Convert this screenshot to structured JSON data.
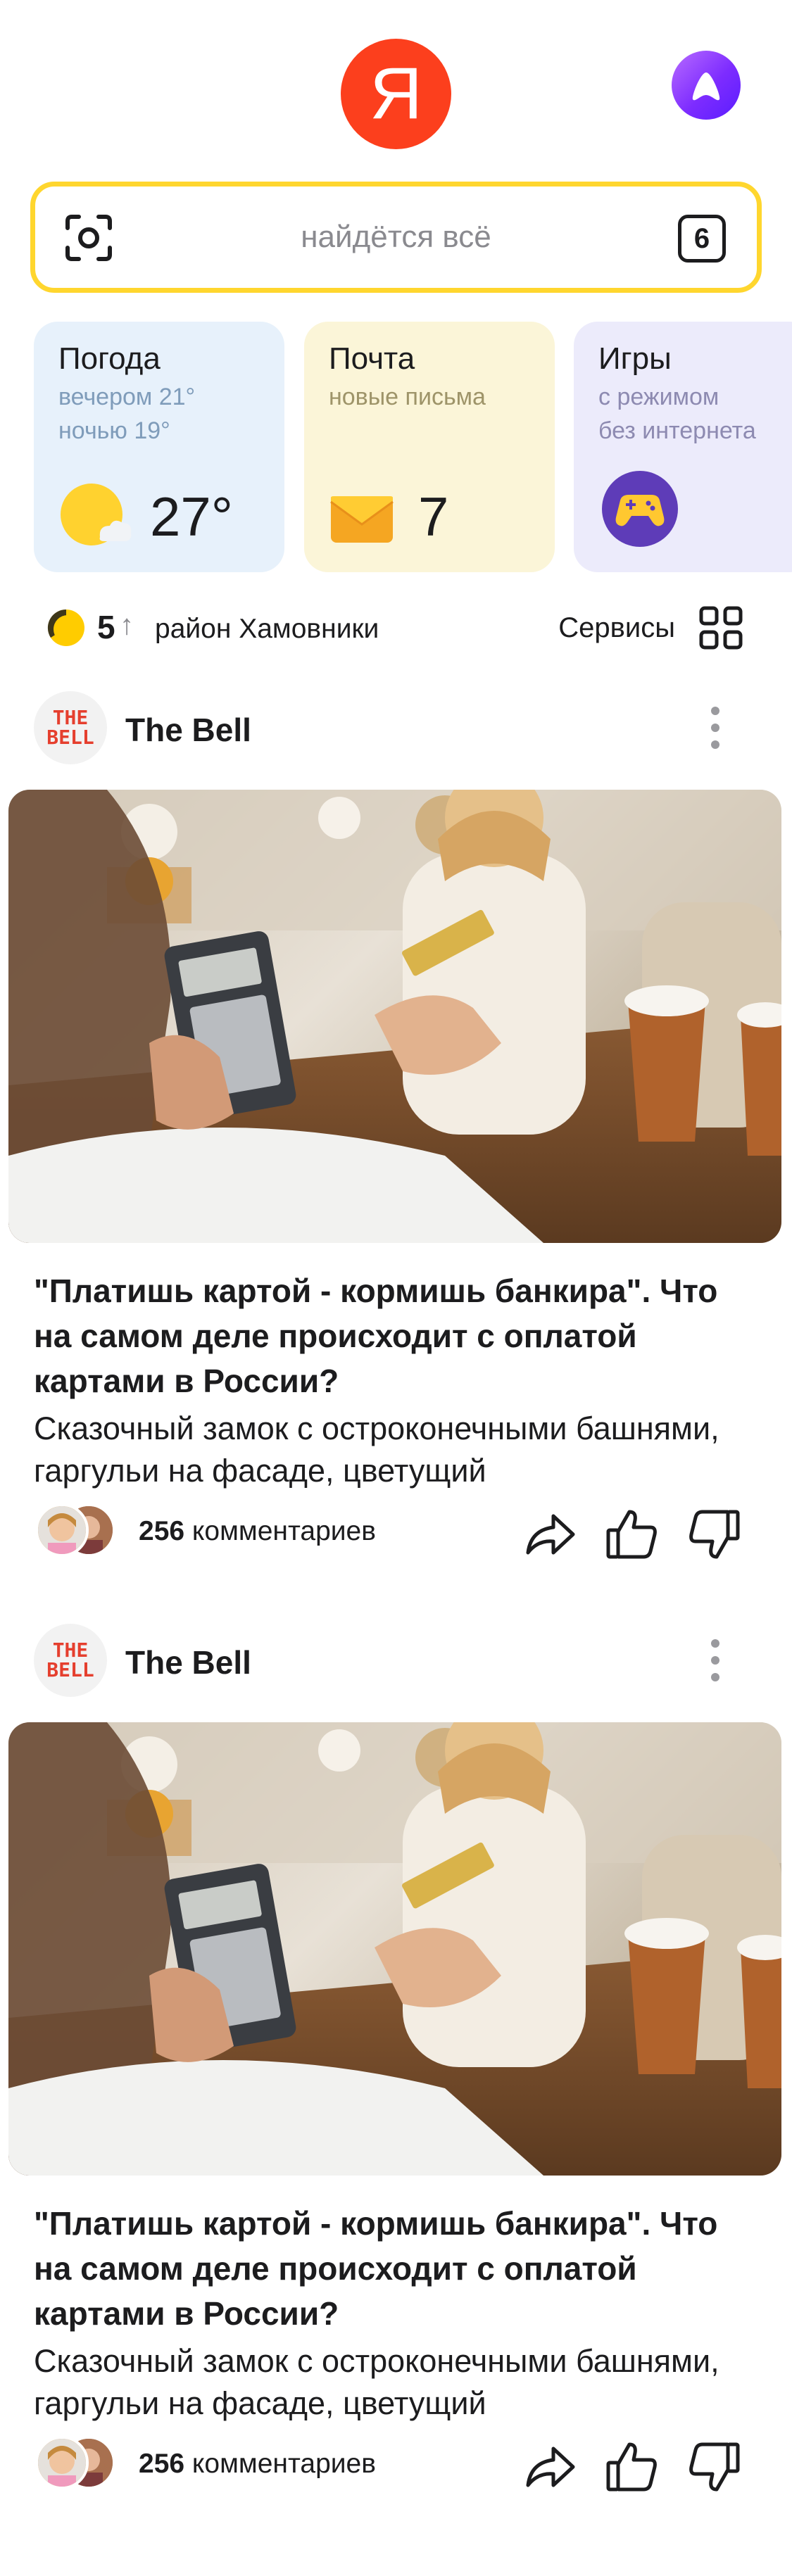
{
  "header": {
    "logo_letter": "Я",
    "brand_color": "#fc3f1d",
    "assistant_icon": "alice-icon"
  },
  "search": {
    "placeholder": "найдётся всё",
    "tabs_count": "6",
    "border_color": "#ffd62e",
    "camera_icon": "camera-search-icon"
  },
  "widgets": [
    {
      "title": "Погода",
      "sub_line1": "вечером 21°",
      "sub_line2": "ночью 19°",
      "value": "27°",
      "icon": "sun-cloud-icon"
    },
    {
      "title": "Почта",
      "sub_line1": "новые письма",
      "value": "7",
      "icon": "envelope-icon"
    },
    {
      "title": "Игры",
      "sub_line1": "с режимом",
      "sub_line2": "без интернета",
      "icon": "gamepad-icon"
    }
  ],
  "infobar": {
    "traffic_level": "5",
    "traffic_arrow": "↑",
    "district": "район Хамовники",
    "services_label": "Сервисы"
  },
  "posts": [
    {
      "source_logo_line1": "THE",
      "source_logo_line2": "BELL",
      "source_name": "The Bell",
      "headline": "\"Платишь картой - кормишь банкира\". Что на самом деле происходит с оплатой картами в России?",
      "lead": "Сказочный замок с остроконечными башнями, гаргульи на фасаде, цветущий",
      "comments_count": "256",
      "comments_label": "комментариев"
    },
    {
      "source_logo_line1": "THE",
      "source_logo_line2": "BELL",
      "source_name": "The Bell",
      "headline": "\"Платишь картой - кормишь банкира\". Что на самом деле происходит с оплатой картами в России?",
      "lead": "Сказочный замок с остроконечными башнями, гаргульи на фасаде, цветущий",
      "comments_count": "256",
      "comments_label": "комментариев"
    }
  ]
}
